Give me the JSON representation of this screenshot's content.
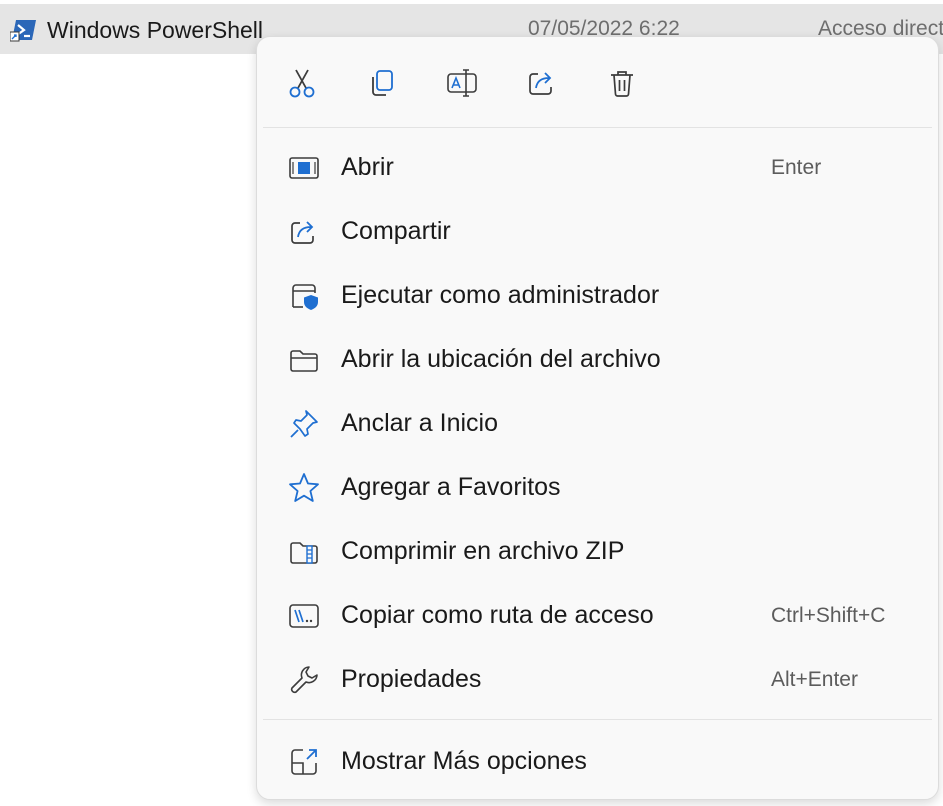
{
  "file_row": {
    "name": "Windows PowerShell",
    "date": "07/05/2022 6:22",
    "type": "Acceso directo",
    "icon": "powershell-shortcut-icon"
  },
  "colors": {
    "accent": "#1f6fd1",
    "menu_background": "#f9f9f9",
    "row_highlight": "#e5e5e5"
  },
  "quick_actions": [
    {
      "label": "Cortar",
      "icon": "cut-icon"
    },
    {
      "label": "Copiar",
      "icon": "copy-icon"
    },
    {
      "label": "Cambiar nombre",
      "icon": "rename-icon"
    },
    {
      "label": "Compartir",
      "icon": "share-icon"
    },
    {
      "label": "Eliminar",
      "icon": "delete-icon"
    }
  ],
  "menu_items": [
    {
      "label": "Abrir",
      "shortcut": "Enter",
      "icon": "open-window-icon"
    },
    {
      "label": "Compartir",
      "shortcut": "",
      "icon": "share-icon"
    },
    {
      "label": "Ejecutar como administrador",
      "shortcut": "",
      "icon": "shield-admin-icon"
    },
    {
      "label": "Abrir la ubicación del archivo",
      "shortcut": "",
      "icon": "folder-icon"
    },
    {
      "label": "Anclar a Inicio",
      "shortcut": "",
      "icon": "pin-icon"
    },
    {
      "label": "Agregar a Favoritos",
      "shortcut": "",
      "icon": "star-icon"
    },
    {
      "label": "Comprimir en archivo ZIP",
      "shortcut": "",
      "icon": "zip-folder-icon"
    },
    {
      "label": "Copiar como ruta de acceso",
      "shortcut": "Ctrl+Shift+C",
      "icon": "copy-path-icon"
    },
    {
      "label": "Propiedades",
      "shortcut": "Alt+Enter",
      "icon": "wrench-icon"
    },
    {
      "label": "Mostrar Más opciones",
      "shortcut": "",
      "icon": "more-options-icon"
    }
  ]
}
